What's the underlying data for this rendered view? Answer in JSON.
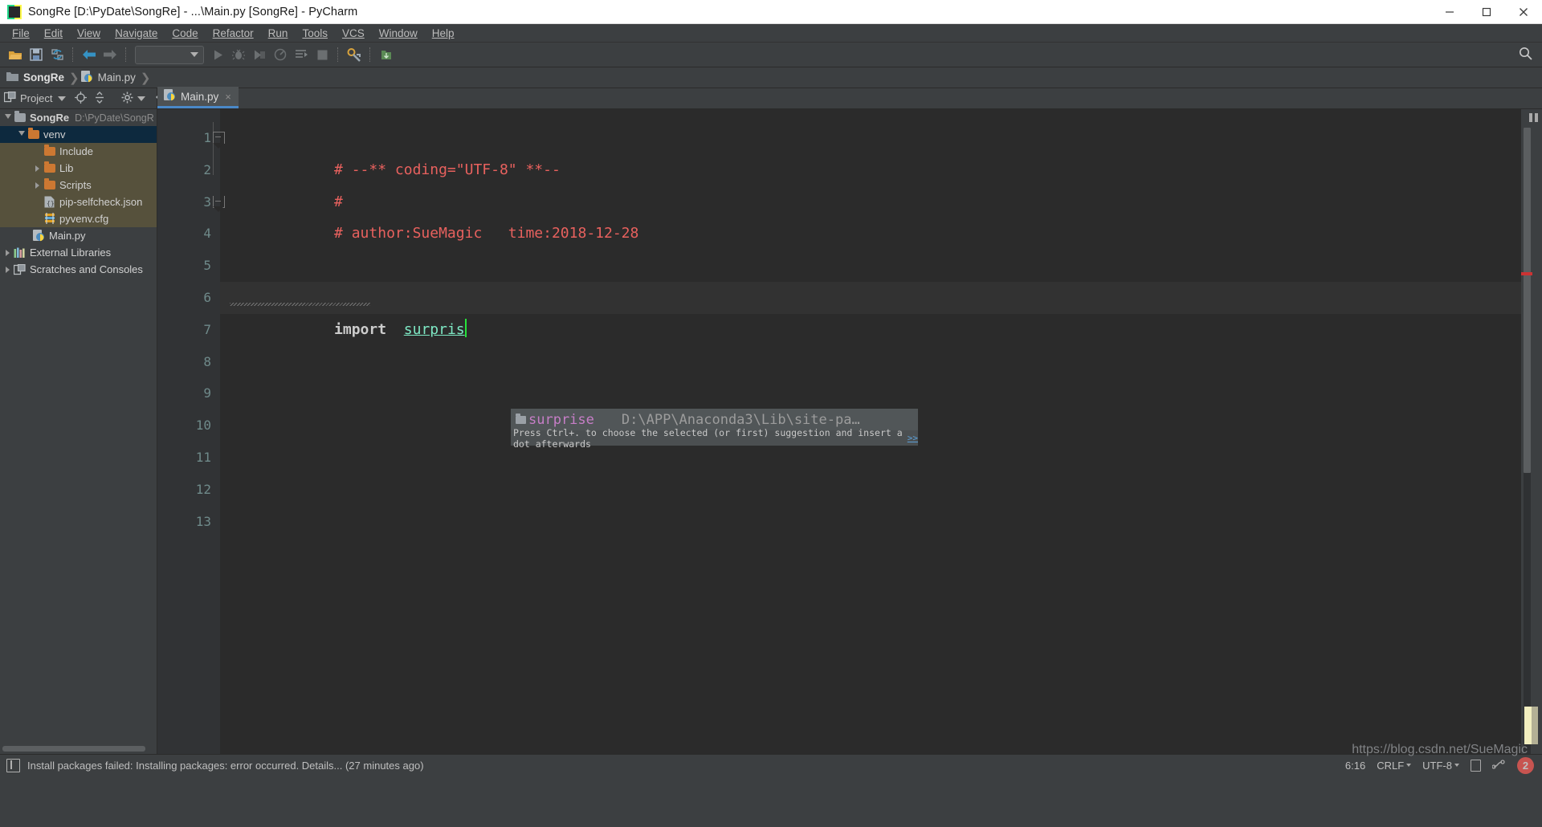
{
  "window": {
    "title": "SongRe [D:\\PyDate\\SongRe] - ...\\Main.py [SongRe] - PyCharm",
    "app_icon": "pycharm-icon",
    "minimize": "minimize-button",
    "maximize": "maximize-button",
    "close": "close-button"
  },
  "menubar": {
    "items": [
      {
        "label": "File"
      },
      {
        "label": "Edit"
      },
      {
        "label": "View"
      },
      {
        "label": "Navigate"
      },
      {
        "label": "Code"
      },
      {
        "label": "Refactor"
      },
      {
        "label": "Run"
      },
      {
        "label": "Tools"
      },
      {
        "label": "VCS"
      },
      {
        "label": "Window"
      },
      {
        "label": "Help"
      }
    ]
  },
  "toolbar": {
    "open_label": "open-project",
    "save_label": "save-all",
    "sync_label": "synchronize",
    "back_label": "navigate-back",
    "forward_label": "navigate-forward",
    "run_config_value": "",
    "run_label": "run",
    "debug_label": "debug",
    "coverage_label": "run-with-coverage",
    "profile_label": "profile",
    "attach_label": "attach-to-process",
    "stop_label": "stop",
    "settings_label": "settings",
    "search_label": "search-everywhere"
  },
  "breadcrumb": {
    "items": [
      {
        "label": "SongRe",
        "icon": "folder-icon"
      },
      {
        "label": "Main.py",
        "icon": "python-file-icon"
      }
    ]
  },
  "sidebar": {
    "header": {
      "title": "Project",
      "dropdown": "▾",
      "locate_icon": "crosshair-icon",
      "collapse_icon": "collapse-all-icon",
      "settings_icon": "gear-icon",
      "hide_icon": "hide-panel-icon"
    },
    "tree": [
      {
        "label": "SongRe",
        "path": "D:\\PyDate\\SongR",
        "depth": 0,
        "arrow": "open",
        "icon": "folder-grey",
        "bold": true,
        "state": "normal"
      },
      {
        "label": "venv",
        "path": "",
        "depth": 1,
        "arrow": "open",
        "icon": "folder-orange",
        "bold": false,
        "state": "selected"
      },
      {
        "label": "Include",
        "path": "",
        "depth": 2,
        "arrow": "none",
        "icon": "folder-orange",
        "bold": false,
        "state": "olive"
      },
      {
        "label": "Lib",
        "path": "",
        "depth": 2,
        "arrow": "closed",
        "icon": "folder-orange",
        "bold": false,
        "state": "olive"
      },
      {
        "label": "Scripts",
        "path": "",
        "depth": 2,
        "arrow": "closed",
        "icon": "folder-orange",
        "bold": false,
        "state": "olive"
      },
      {
        "label": "pip-selfcheck.json",
        "path": "",
        "depth": 2,
        "arrow": "none",
        "icon": "json-file-icon",
        "bold": false,
        "state": "olive"
      },
      {
        "label": "pyvenv.cfg",
        "path": "",
        "depth": 2,
        "arrow": "none",
        "icon": "cfg-file-icon",
        "bold": false,
        "state": "olive"
      },
      {
        "label": "Main.py",
        "path": "",
        "depth": 1,
        "arrow": "none",
        "icon": "python-file-icon",
        "bold": false,
        "state": "normal"
      },
      {
        "label": "External Libraries",
        "path": "",
        "depth": 0,
        "arrow": "closed",
        "icon": "libraries-icon",
        "bold": false,
        "state": "normal"
      },
      {
        "label": "Scratches and Consoles",
        "path": "",
        "depth": 0,
        "arrow": "closed",
        "icon": "scratches-icon",
        "bold": false,
        "state": "normal"
      }
    ]
  },
  "editor": {
    "tab": {
      "label": "Main.py",
      "icon": "python-file-icon",
      "close": "×"
    },
    "line_numbers": [
      "1",
      "2",
      "3",
      "4",
      "5",
      "6",
      "7",
      "8",
      "9",
      "10",
      "11",
      "12",
      "13"
    ],
    "lines": [
      {
        "n": 1,
        "tokens": [
          {
            "t": "comment",
            "v": "# --** coding=\"UTF-8\" **--"
          }
        ],
        "fold": "start"
      },
      {
        "n": 2,
        "tokens": [
          {
            "t": "comment",
            "v": "#"
          }
        ],
        "fold": "none"
      },
      {
        "n": 3,
        "tokens": [
          {
            "t": "comment",
            "v": "# author:SueMagic   time:2018-12-28"
          }
        ],
        "fold": "end"
      },
      {
        "n": 4,
        "tokens": [],
        "fold": "none"
      },
      {
        "n": 5,
        "tokens": [],
        "fold": "none"
      },
      {
        "n": 6,
        "tokens": [
          {
            "t": "keyword",
            "v": "import"
          },
          {
            "t": "plain",
            "v": "  "
          },
          {
            "t": "module",
            "v": "surpris"
          }
        ],
        "fold": "none",
        "current": true
      },
      {
        "n": 7,
        "tokens": [],
        "fold": "none"
      },
      {
        "n": 8,
        "tokens": [],
        "fold": "none"
      },
      {
        "n": 9,
        "tokens": [],
        "fold": "none"
      },
      {
        "n": 10,
        "tokens": [],
        "fold": "none"
      },
      {
        "n": 11,
        "tokens": [],
        "fold": "none"
      },
      {
        "n": 12,
        "tokens": [],
        "fold": "none"
      },
      {
        "n": 13,
        "tokens": [],
        "fold": "none"
      }
    ],
    "code_line1": "# --** coding=\"UTF-8\" **--",
    "code_line2": "#",
    "code_line3": "# author:SueMagic   time:2018-12-28",
    "code_line6_kw": "import",
    "code_line6_mod": "surpris"
  },
  "completion": {
    "item_name": "surprise",
    "item_path": "D:\\APP\\Anaconda3\\Lib\\site-pa…",
    "hint": "Press Ctrl+. to choose the selected (or first) suggestion and insert a dot afterwards",
    "hint_more": ">>",
    "folder_icon": "folder-icon"
  },
  "statusbar": {
    "message": "Install packages failed: Installing packages: error occurred. Details... (27 minutes ago)",
    "icon": "event-log-icon",
    "caret_position": "6:16",
    "line_separator": "CRLF",
    "encoding": "UTF-8",
    "lock_icon": "lock-icon",
    "git_icon": "git-branch-icon",
    "notification_count": "2",
    "watermark": "https://blog.csdn.net/SueMagic"
  },
  "colors": {
    "comment": "#e8615e",
    "keyword": "#cccccc",
    "module": "#7ee8c4",
    "caret": "#25e33a",
    "accent_tab": "#4a88c7",
    "selection": "#0d293e",
    "olive": "#56513c",
    "folder_orange": "#cc7832",
    "error_marker": "#cc3333",
    "popup_name": "#c77ec7",
    "background_editor": "#2b2b2b",
    "background_chrome": "#3c3f41"
  }
}
